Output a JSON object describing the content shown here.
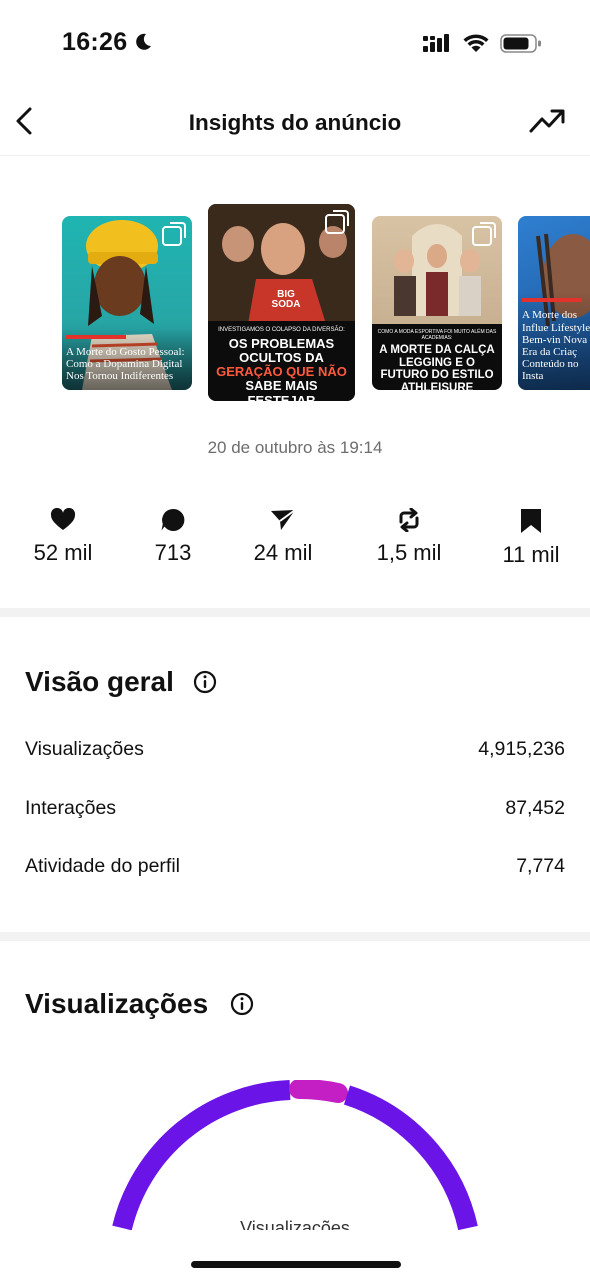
{
  "status_bar": {
    "time": "16:26",
    "icons": [
      "moon-icon",
      "signal-icon",
      "wifi-icon",
      "battery-icon"
    ]
  },
  "header": {
    "title": "Insights do anúncio",
    "back_icon": "chevron-left-icon",
    "trend_icon": "trending-up-icon"
  },
  "thumbnails": [
    {
      "caption": "A Morte do Gosto Pessoal: Como a Dopamina Digital Nos Tornou Indiferentes"
    },
    {
      "kicker": "INVESTIGAMOS O COLAPSO DA DIVERSÃO:",
      "caption_a": "OS PROBLEMAS OCULTOS DA ",
      "caption_hl": "GERAÇÃO QUE NÃO",
      "caption_b": " SABE MAIS FESTEJAR",
      "shirt": "BIG SODA"
    },
    {
      "kicker": "COMO A MODA ESPORTIVA FOI MUITO ALÉM DAS ACADEMIAS:",
      "caption": "A MORTE DA CALÇA LEGGING E O FUTURO DO ESTILO ATHLEISURE"
    },
    {
      "caption": "A Morte dos Influe Lifestyle: Bem-vin Nova Era da Criaç Conteúdo no Insta"
    }
  ],
  "post_date": "20 de outubro às 19:14",
  "metrics": [
    {
      "icon": "heart-icon",
      "value": "52 mil"
    },
    {
      "icon": "comment-icon",
      "value": "713"
    },
    {
      "icon": "share-icon",
      "value": "24 mil"
    },
    {
      "icon": "repost-icon",
      "value": "1,5 mil"
    },
    {
      "icon": "bookmark-icon",
      "value": "11 mil"
    }
  ],
  "overview": {
    "title": "Visão geral",
    "rows": [
      {
        "label": "Visualizações",
        "value": "4,915,236"
      },
      {
        "label": "Interações",
        "value": "87,452"
      },
      {
        "label": "Atividade do perfil",
        "value": "7,774"
      }
    ]
  },
  "views_section": {
    "title": "Visualizações",
    "gauge_label": "Visualizações",
    "colors": {
      "primary": "#6a14e8",
      "secondary": "#c41fc4"
    }
  }
}
